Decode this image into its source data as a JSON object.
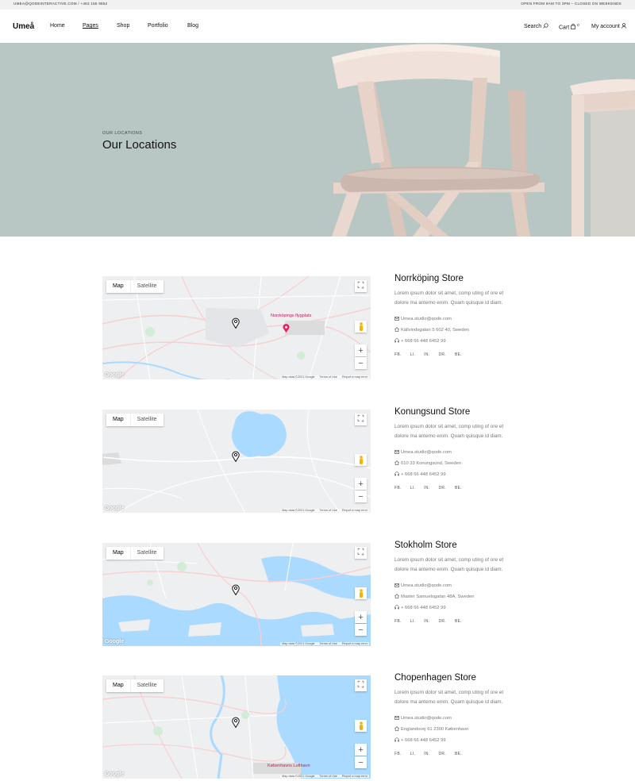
{
  "topbar": {
    "left": "UMEA@QODEINTERACTIVE.COM / +463 155 9852",
    "right": "OPEN FROM 9AM TO 3PM – CLOSED ON WEEKENDS"
  },
  "header": {
    "logo": "Umeå",
    "nav": [
      "Home",
      "Pages",
      "Shop",
      "Portfolio",
      "Blog"
    ],
    "search": "Search",
    "cart": "Cart",
    "cart_count": "0",
    "account": "My account"
  },
  "hero": {
    "subtitle": "OUR LOCATIONS",
    "title": "Our Locations"
  },
  "map_ui": {
    "tab_map": "Map",
    "tab_satellite": "Satellite",
    "google": "Google",
    "map_data": "Map data ©2021 Google",
    "terms": "Terms of Use",
    "report": "Report a map error"
  },
  "stores": [
    {
      "name": "Norrköping Store",
      "description": "Lorem ipsum dolor sit amet, comp uting of ore et dolore ma antemo enim. Quam quisque id diam.",
      "email": "Umea.studio@qode.com",
      "address": "Källvindsgatan 5 602 40, Sweden",
      "phone": "+ 668 66 448 6452 99",
      "poi": "Norrköpings flygplats"
    },
    {
      "name": "Konungsund Store",
      "description": "Lorem ipsum dolor sit amet, comp uting of ore et dolore ma antemo enim. Quam quisque id diam.",
      "email": "Umea.studio@qode.com",
      "address": "610 33 Konungsund, Sweden",
      "phone": "+ 668 66 448 6452 99",
      "poi": ""
    },
    {
      "name": "Stokholm Store",
      "description": "Lorem ipsum dolor sit amet, comp uting of ore et dolore ma antemo enim. Quam quisque id diam.",
      "email": "Umea.studio@qode.com",
      "address": "Master Samuelsgatan 48A, Sweden",
      "phone": "+ 668 66 448 6452 99",
      "poi": ""
    },
    {
      "name": "Chopenhagen Store",
      "description": "Lorem ipsum dolor sit amet, comp uting of ore et dolore ma antemo enim. Quam quisque id diam.",
      "email": "Umea.studio@qode.com",
      "address": "Englandsvej 61 2300 København",
      "phone": "+ 668 66 448 6452 99",
      "poi": "Københavns Lufthavn"
    }
  ],
  "social": [
    "FB.",
    "LI.",
    "IN.",
    "DR.",
    "BE."
  ],
  "colors": {
    "hero_bg": "#b8c7c3",
    "chair": "#ead7cf",
    "poi": "#c2185b",
    "water": "#aadaff"
  }
}
